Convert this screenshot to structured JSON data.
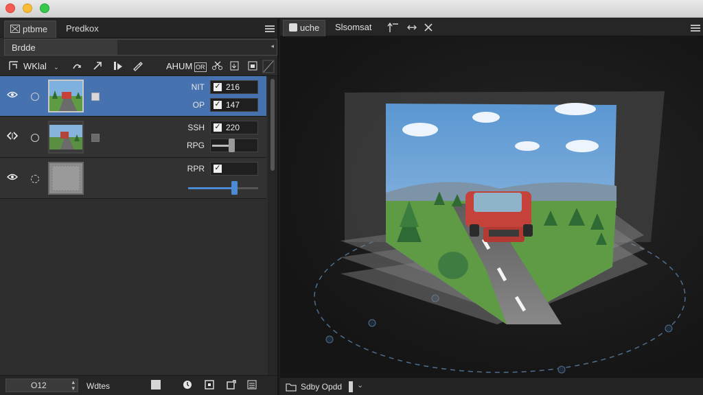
{
  "left_panel": {
    "tabs": [
      {
        "label": "ptbme"
      },
      {
        "label": "Predkox"
      }
    ],
    "bridge_label": "Brdde",
    "toolbar": {
      "name_label": "WKlal",
      "aux_label": "AHUM",
      "or_label": "OR"
    },
    "layers": [
      {
        "selected": true,
        "params": [
          {
            "label": "NIT",
            "checked": true,
            "value": "216"
          },
          {
            "label": "OP",
            "checked": true,
            "value": "147"
          }
        ]
      },
      {
        "selected": false,
        "params": [
          {
            "label": "SSH",
            "checked": true,
            "value": "220"
          },
          {
            "label": "RPG",
            "slider": 0.5
          }
        ]
      },
      {
        "selected": false,
        "params": [
          {
            "label": "RPR",
            "checked": true,
            "value": ""
          },
          {
            "label": "",
            "slider": 0.62
          }
        ]
      }
    ],
    "bottom": {
      "field_value": "O12",
      "text": "Wdtes"
    }
  },
  "right_panel": {
    "tabs": [
      {
        "label": "uche"
      },
      {
        "label": "Slsomsat"
      }
    ],
    "status_text": "Sdby Opdd"
  },
  "colors": {
    "selection": "#4672b0",
    "sky": "#6fa6d8",
    "grass": "#5f9a45",
    "car": "#c4423a"
  }
}
